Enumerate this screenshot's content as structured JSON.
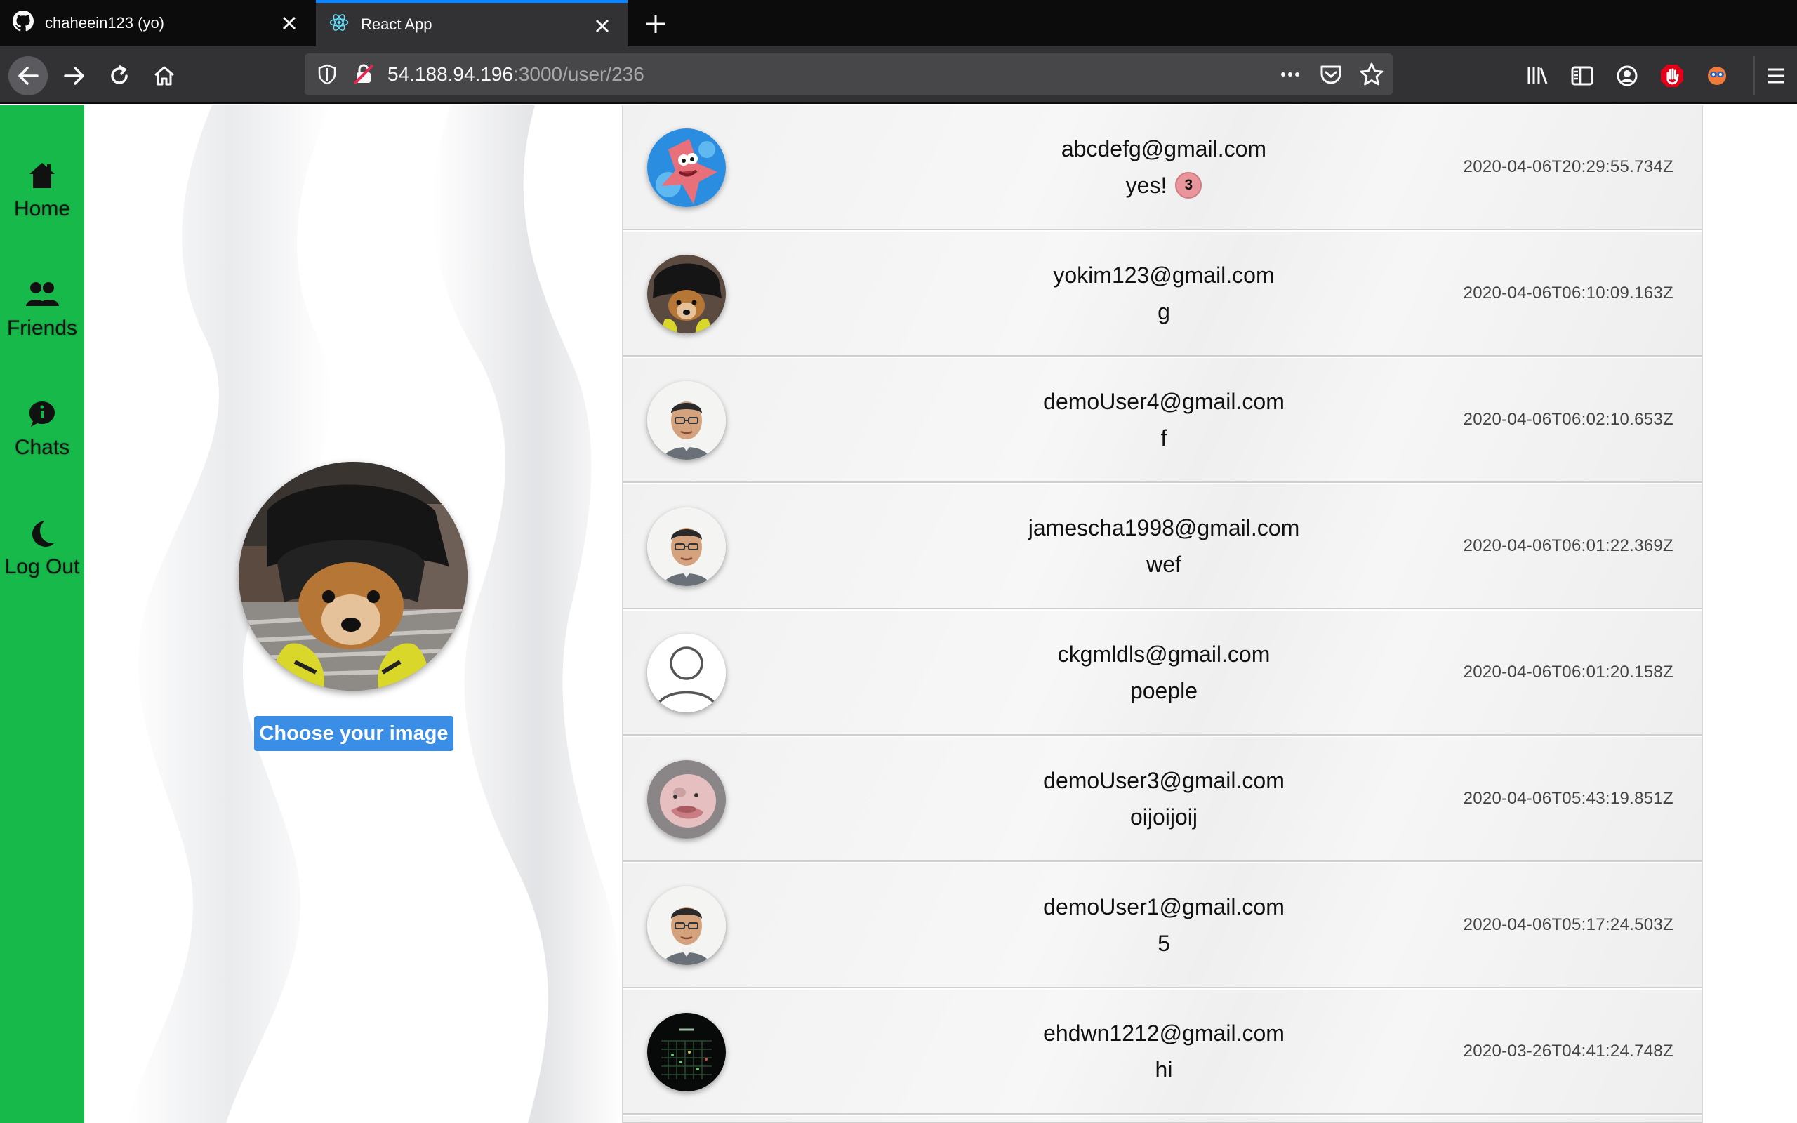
{
  "browser": {
    "tabs": [
      {
        "title": "chaheein123 (yo)",
        "icon": "github-icon",
        "active": false
      },
      {
        "title": "React App",
        "icon": "react-icon",
        "active": true
      }
    ],
    "url": {
      "host": "54.188.94.196",
      "path": ":3000/user/236"
    }
  },
  "sidebar": {
    "items": [
      {
        "label": "Home",
        "icon": "home-icon"
      },
      {
        "label": "Friends",
        "icon": "friends-icon"
      },
      {
        "label": "Chats",
        "icon": "chat-icon"
      },
      {
        "label": "Log Out",
        "icon": "moon-icon"
      }
    ]
  },
  "profile": {
    "choose_image_label": "Choose your image"
  },
  "chats": [
    {
      "email": "abcdefg@gmail.com",
      "message": "yes!",
      "unread": "3",
      "time": "2020-04-06T20:29:55.734Z",
      "avatar": "cartoon-starfish"
    },
    {
      "email": "yokim123@gmail.com",
      "message": "g",
      "unread": "",
      "time": "2020-04-06T06:10:09.163Z",
      "avatar": "dog-photo"
    },
    {
      "email": "demoUser4@gmail.com",
      "message": "f",
      "unread": "",
      "time": "2020-04-06T06:02:10.653Z",
      "avatar": "man-photo"
    },
    {
      "email": "jamescha1998@gmail.com",
      "message": "wef",
      "unread": "",
      "time": "2020-04-06T06:01:22.369Z",
      "avatar": "man-photo"
    },
    {
      "email": "ckgmldls@gmail.com",
      "message": "poeple",
      "unread": "",
      "time": "2020-04-06T06:01:20.158Z",
      "avatar": "default-user"
    },
    {
      "email": "demoUser3@gmail.com",
      "message": "oijoijoij",
      "unread": "",
      "time": "2020-04-06T05:43:19.851Z",
      "avatar": "blobfish-photo"
    },
    {
      "email": "demoUser1@gmail.com",
      "message": "5",
      "unread": "",
      "time": "2020-04-06T05:17:24.503Z",
      "avatar": "man-photo"
    },
    {
      "email": "ehdwn1212@gmail.com",
      "message": "hi",
      "unread": "",
      "time": "2020-03-26T04:41:24.748Z",
      "avatar": "dark-screen"
    }
  ]
}
